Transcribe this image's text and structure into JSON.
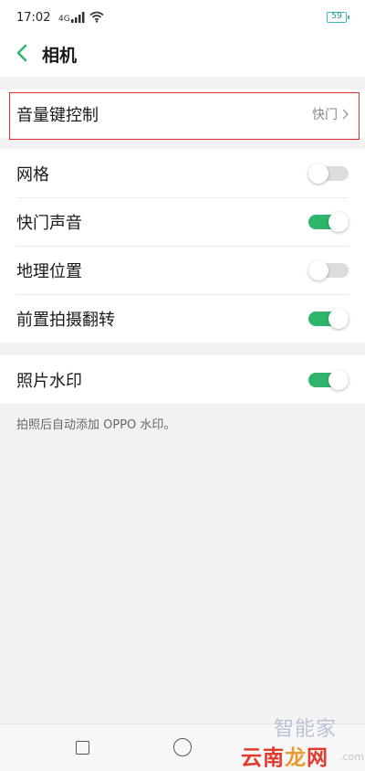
{
  "status_bar": {
    "time": "17:02",
    "battery": "59",
    "icons": [
      "signal-icon",
      "wifi-icon"
    ]
  },
  "header": {
    "title": "相机",
    "back_icon": "chevron-left-icon"
  },
  "volume_key": {
    "label": "音量键控制",
    "value": "快门"
  },
  "toggles": [
    {
      "label": "网格",
      "on": false
    },
    {
      "label": "快门声音",
      "on": true
    },
    {
      "label": "地理位置",
      "on": false
    },
    {
      "label": "前置拍摄翻转",
      "on": true
    }
  ],
  "watermark_setting": {
    "label": "照片水印",
    "on": true,
    "description": "拍照后自动添加 OPPO 水印。"
  },
  "site_watermark": {
    "top": "智能家",
    "bottom": [
      "云",
      "南",
      "龙",
      "网"
    ],
    "suffix": ".com"
  },
  "colors": {
    "accent": "#2fb46b",
    "highlight": "#e0302f",
    "toggle_off": "#dcdcdc"
  }
}
